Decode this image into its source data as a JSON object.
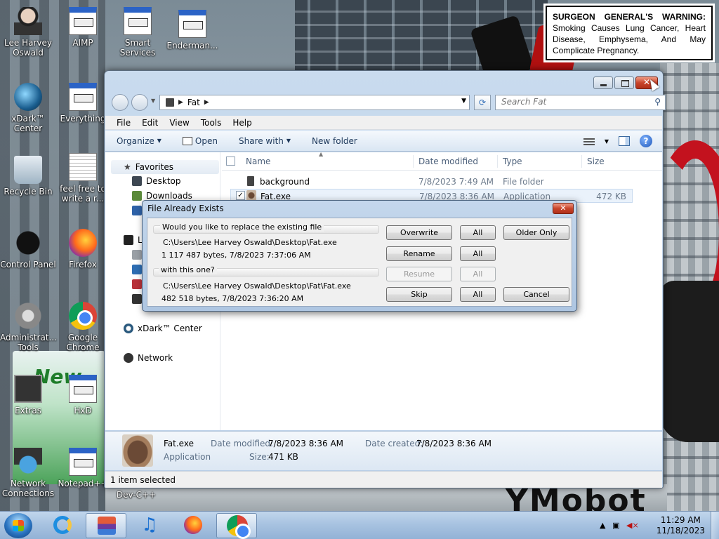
{
  "warning": {
    "heading": "SURGEON GENERAL'S WARNING:",
    "body": "Smoking Causes Lung Cancer, Heart Disease, Emphysema, And May Complicate Pregnancy."
  },
  "desktop_icons": [
    {
      "label": "Lee Harvey Oswald"
    },
    {
      "label": "AIMP"
    },
    {
      "label": "Smart Services"
    },
    {
      "label": "Enderman..."
    },
    {
      "label": "xDark™ Center"
    },
    {
      "label": "Everything"
    },
    {
      "label": "Recycle Bin"
    },
    {
      "label": "feel free to write a r..."
    },
    {
      "label": "Control Panel"
    },
    {
      "label": "Firefox"
    },
    {
      "label": "Administrat... Tools"
    },
    {
      "label": "Google Chrome"
    },
    {
      "label": "Extras"
    },
    {
      "label": "HxD"
    },
    {
      "label": "Network Connections"
    },
    {
      "label": "Notepad++"
    },
    {
      "label": "Dev-C++"
    }
  ],
  "wallpaper_text": {
    "brand": "New",
    "bottom": "YMobot"
  },
  "explorer": {
    "breadcrumb": [
      "Fat"
    ],
    "search_placeholder": "Search Fat",
    "menu": [
      "File",
      "Edit",
      "View",
      "Tools",
      "Help"
    ],
    "commands": {
      "organize": "Organize",
      "open": "Open",
      "share": "Share with",
      "new_folder": "New folder"
    },
    "nav": {
      "favorites": "Favorites",
      "desktop": "Desktop",
      "downloads": "Downloads",
      "libraries_partial": "L",
      "xdark": "xDark™ Center",
      "network": "Network"
    },
    "columns": {
      "name": "Name",
      "date": "Date modified",
      "type": "Type",
      "size": "Size"
    },
    "files": [
      {
        "name": "background",
        "date": "7/8/2023 7:49 AM",
        "type": "File folder",
        "size": ""
      },
      {
        "name": "Fat.exe",
        "date": "7/8/2023 8:36 AM",
        "type": "Application",
        "size": "472 KB"
      }
    ],
    "details": {
      "name": "Fat.exe",
      "kind": "Application",
      "modified_label": "Date modified:",
      "modified_value": "7/8/2023 8:36 AM",
      "created_label": "Date created:",
      "created_value": "7/8/2023 8:36 AM",
      "size_label": "Size:",
      "size_value": "471 KB"
    },
    "status": "1 item selected"
  },
  "dialog": {
    "title": "File Already Exists",
    "question": "Would you like to replace the existing file",
    "existing_path": "C:\\Users\\Lee Harvey Oswald\\Desktop\\Fat.exe",
    "existing_info": "1 117 487 bytes, 7/8/2023 7:37:06 AM",
    "with_label": "with this one?",
    "new_path": "C:\\Users\\Lee Harvey Oswald\\Desktop\\Fat\\Fat.exe",
    "new_info": "482 518 bytes, 7/8/2023 7:36:20 AM",
    "buttons": {
      "overwrite": "Overwrite",
      "all": "All",
      "older_only": "Older Only",
      "rename": "Rename",
      "resume": "Resume",
      "skip": "Skip",
      "cancel": "Cancel"
    }
  },
  "taskbar": {
    "time": "11:29 AM",
    "date": "11/18/2023"
  }
}
